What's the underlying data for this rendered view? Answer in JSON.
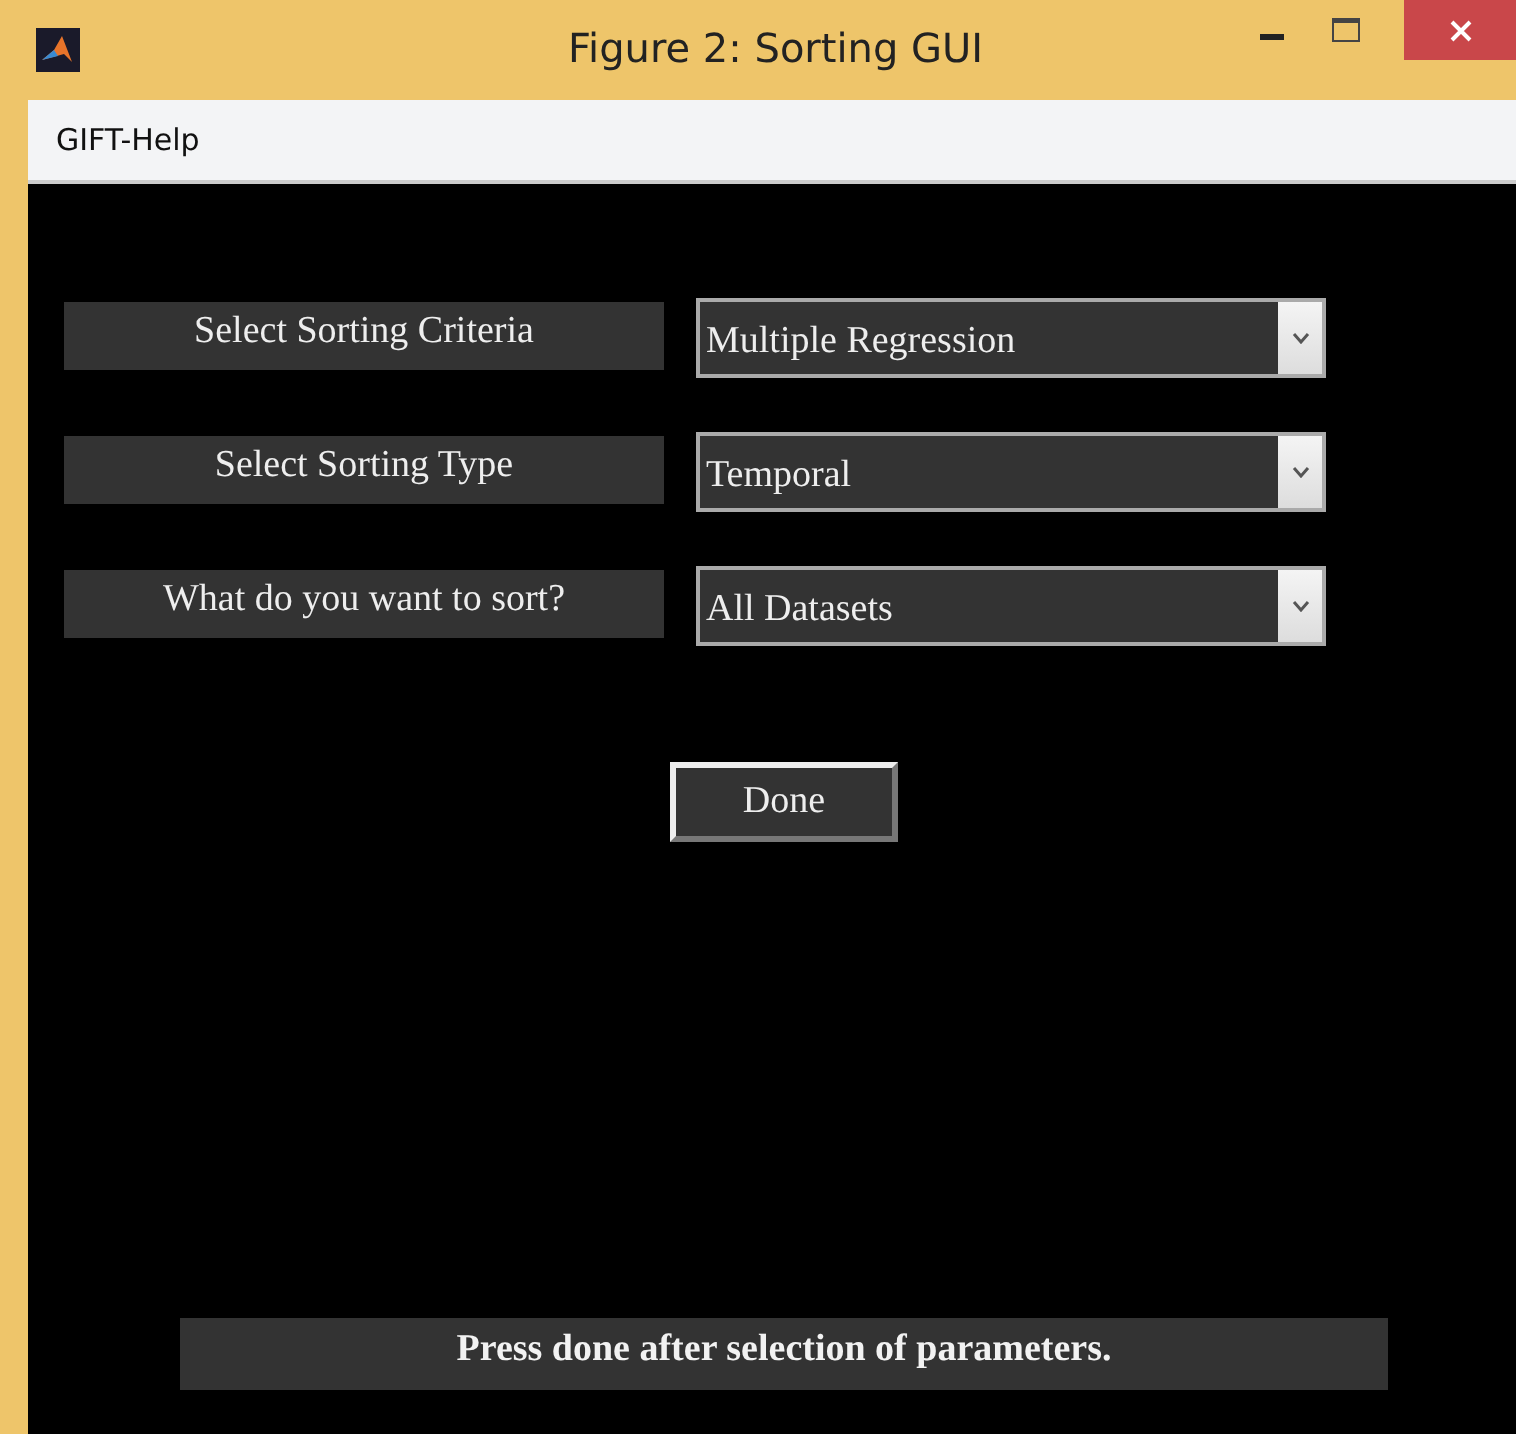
{
  "window": {
    "title": "Figure 2: Sorting GUI"
  },
  "menu": [
    "GIFT-Help"
  ],
  "rows": [
    {
      "label": "Select Sorting Criteria",
      "value": "Multiple Regression"
    },
    {
      "label": "Select Sorting Type",
      "value": "Temporal"
    },
    {
      "label": "What do you want to sort?",
      "value": "All Datasets"
    }
  ],
  "button": "Done",
  "status": "Press done after selection of parameters."
}
